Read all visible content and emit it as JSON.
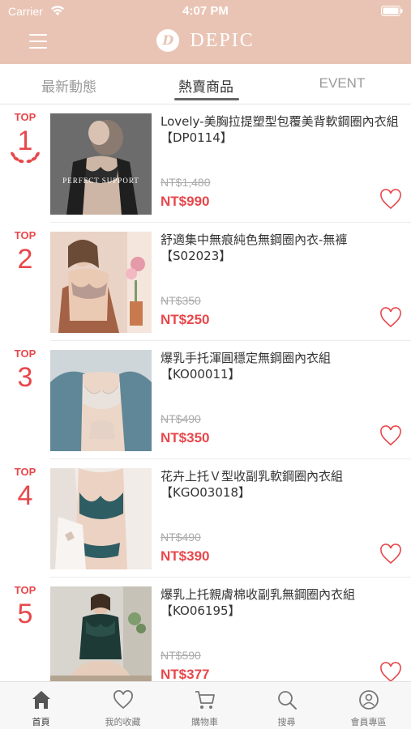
{
  "status": {
    "carrier": "Carrier",
    "time": "4:07 PM"
  },
  "header": {
    "logo_text": "DEPIC"
  },
  "tabs": [
    {
      "label": "最新動態"
    },
    {
      "label": "熱賣商品"
    },
    {
      "label": "EVENT"
    }
  ],
  "active_tab": "熱賣商品",
  "products": [
    {
      "rank_label": "TOP",
      "rank": "1",
      "title": "Lovely-美胸拉提塑型包覆美背軟鋼圈內衣組【DP0114】",
      "old_price": "NT$1,480",
      "price": "NT$990",
      "image_caption": "PERFECT SUPPORT"
    },
    {
      "rank_label": "TOP",
      "rank": "2",
      "title": "舒適集中無痕純色無鋼圈內衣-無褲【S02023】",
      "old_price": "NT$350",
      "price": "NT$250"
    },
    {
      "rank_label": "TOP",
      "rank": "3",
      "title": "爆乳手托渾圓穩定無鋼圈內衣組【KO00011】",
      "old_price": "NT$490",
      "price": "NT$350"
    },
    {
      "rank_label": "TOP",
      "rank": "4",
      "title": "花卉上托Ｖ型收副乳軟鋼圈內衣組【KGO03018】",
      "old_price": "NT$490",
      "price": "NT$390"
    },
    {
      "rank_label": "TOP",
      "rank": "5",
      "title": "爆乳上托親膚棉收副乳無鋼圈內衣組【KO06195】",
      "old_price": "NT$590",
      "price": "NT$377"
    }
  ],
  "bottom_nav": [
    {
      "label": "首頁",
      "icon": "home-icon"
    },
    {
      "label": "我的收藏",
      "icon": "heart-icon"
    },
    {
      "label": "購物車",
      "icon": "cart-icon"
    },
    {
      "label": "搜尋",
      "icon": "search-icon"
    },
    {
      "label": "會員專區",
      "icon": "user-icon"
    }
  ],
  "colors": {
    "header": "#e9c4b4",
    "accent_red": "#e8474b"
  }
}
